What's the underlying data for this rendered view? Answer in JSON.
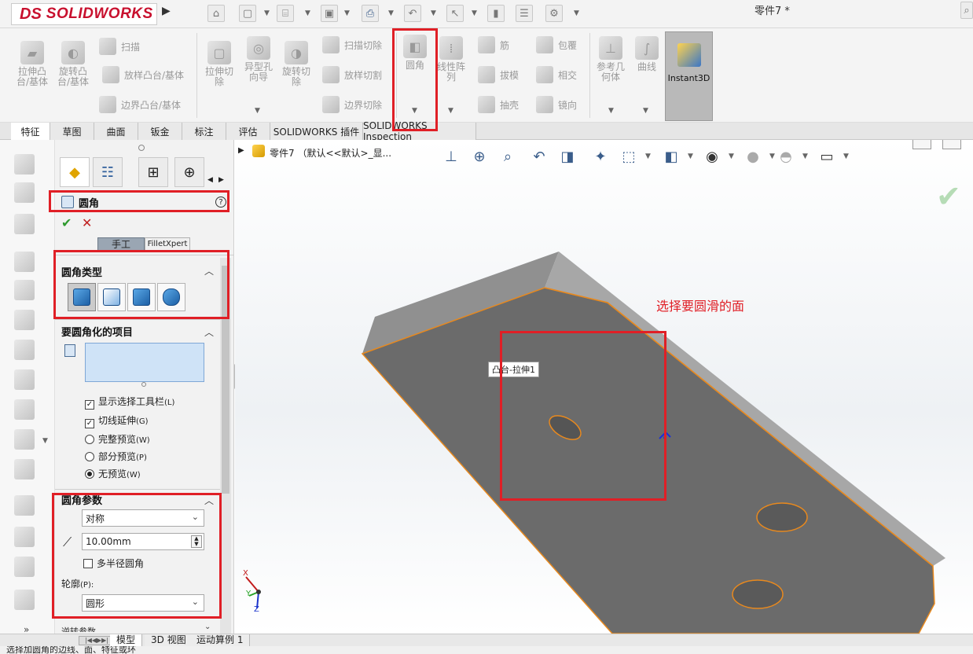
{
  "app": {
    "logo_ds": "DS",
    "logo_text": "SOLIDWORKS",
    "document_title": "零件7 *"
  },
  "ribbon": {
    "extrude_boss": "拉伸凸\n台/基体",
    "revolve_boss": "旋转凸\n台/基体",
    "sweep": "扫描",
    "loft_boss": "放样凸台/基体",
    "boundary_boss": "边界凸台/基体",
    "extrude_cut": "拉伸切\n除",
    "hole_wizard": "异型孔\n向导",
    "revolve_cut": "旋转切\n除",
    "sweep_cut": "扫描切除",
    "loft_cut": "放样切割",
    "boundary_cut": "边界切除",
    "fillet": "圆角",
    "linear_pattern": "线性阵\n列",
    "rib": "筋",
    "draft": "拔模",
    "shell": "抽壳",
    "wrap": "包覆",
    "intersect": "相交",
    "mirror": "镜向",
    "ref_geometry": "参考几\n何体",
    "curves": "曲线",
    "instant3d": "Instant3D"
  },
  "tabs": [
    "特征",
    "草图",
    "曲面",
    "钣金",
    "标注",
    "评估",
    "SOLIDWORKS 插件",
    "SOLIDWORKS Inspection"
  ],
  "property_manager": {
    "title": "圆角",
    "help": "?",
    "ok": "✔",
    "cancel": "✕",
    "mode_manual": "手工",
    "mode_filletxpert": "FilletXpert",
    "fillet_type_title": "圆角类型",
    "items_title": "要圆角化的项目",
    "options": [
      {
        "label": "显示选择工具栏",
        "key": "(L)",
        "type": "checkbox",
        "checked": true
      },
      {
        "label": "切线延伸",
        "key": "(G)",
        "type": "checkbox",
        "checked": true
      },
      {
        "label": "完整预览",
        "key": "(W)",
        "type": "radio",
        "checked": false
      },
      {
        "label": "部分预览",
        "key": "(P)",
        "type": "radio",
        "checked": false
      },
      {
        "label": "无预览",
        "key": "(W)",
        "type": "radio",
        "checked": true
      }
    ],
    "params_title": "圆角参数",
    "symmetric": "对称",
    "radius_value": "10.00mm",
    "multi_radius": "多半径圆角",
    "profile_label": "轮廓",
    "profile_key": "(P):",
    "profile_value": "圆形",
    "next_section": "逆转参数"
  },
  "viewport": {
    "tree_item": "零件7 （默认<<默认>_显...",
    "hover_label": "凸台-拉伸1",
    "annotation": "选择要圆滑的面",
    "triad_x": "X",
    "triad_y": "Y",
    "triad_z": "Z"
  },
  "bottom_tabs": [
    "模型",
    "3D 视图",
    "运动算例 1"
  ],
  "status_text": "选择加圆角的边线、面、特征或环",
  "colors": {
    "highlight": "#e01f26",
    "part_face": "#6b6b6b",
    "part_edge": "#e8891e",
    "annotation": "#e01f26"
  }
}
